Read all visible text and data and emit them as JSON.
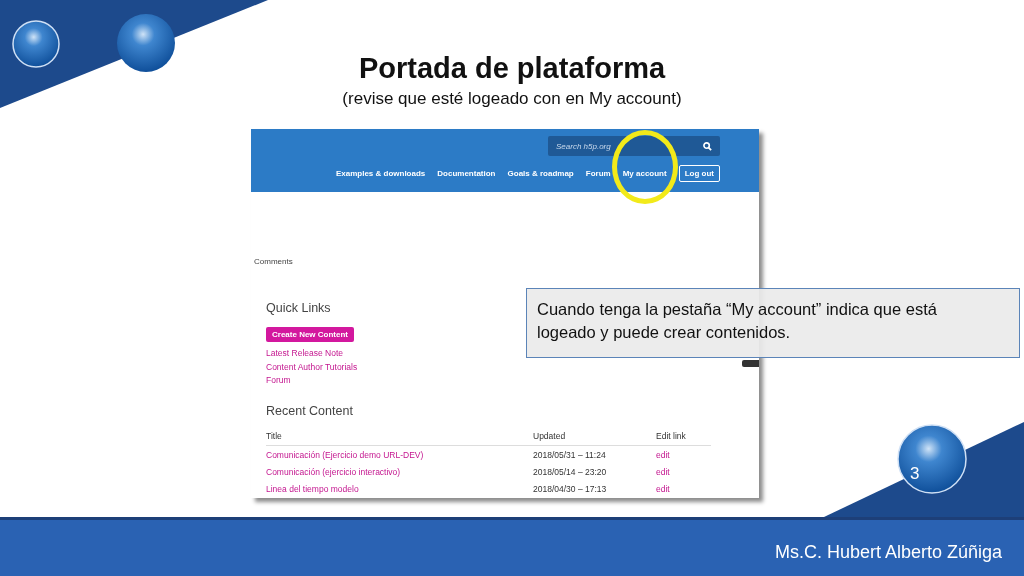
{
  "slide": {
    "title": "Portada de plataforma",
    "subtitle": "(revise que esté logeado con en My account)",
    "page_number": "3",
    "footer": "Ms.C. Hubert Alberto Zúñiga"
  },
  "screenshot": {
    "search": {
      "placeholder": "Search h5p.org"
    },
    "nav": [
      {
        "label": "Examples & downloads",
        "kind": "link",
        "highlighted": false
      },
      {
        "label": "Documentation",
        "kind": "link",
        "highlighted": false
      },
      {
        "label": "Goals & roadmap",
        "kind": "link",
        "highlighted": false
      },
      {
        "label": "Forum",
        "kind": "link",
        "highlighted": false
      },
      {
        "label": "My account",
        "kind": "link",
        "highlighted": true
      },
      {
        "label": "Log out",
        "kind": "button",
        "highlighted": false
      }
    ],
    "comments_label": "Comments",
    "quick_links": {
      "heading": "Quick Links",
      "button": "Create New Content",
      "links": [
        "Latest Release Note",
        "Content Author Tutorials",
        "Forum"
      ]
    },
    "recent_content": {
      "heading": "Recent Content",
      "columns": [
        "Title",
        "Updated",
        "Edit link"
      ],
      "rows": [
        {
          "title": "Comunicación (Ejercicio demo URL-DEV)",
          "updated": "2018/05/31 – 11:24",
          "edit": "edit"
        },
        {
          "title": "Comunicación (ejercicio interactivo)",
          "updated": "2018/05/14 – 23:20",
          "edit": "edit"
        },
        {
          "title": "Linea del tiempo modelo",
          "updated": "2018/04/30 – 17:13",
          "edit": "edit"
        }
      ]
    }
  },
  "callout": {
    "text": "Cuando tenga la pestaña “My account” indica que está logeado y puede crear contenidos."
  }
}
